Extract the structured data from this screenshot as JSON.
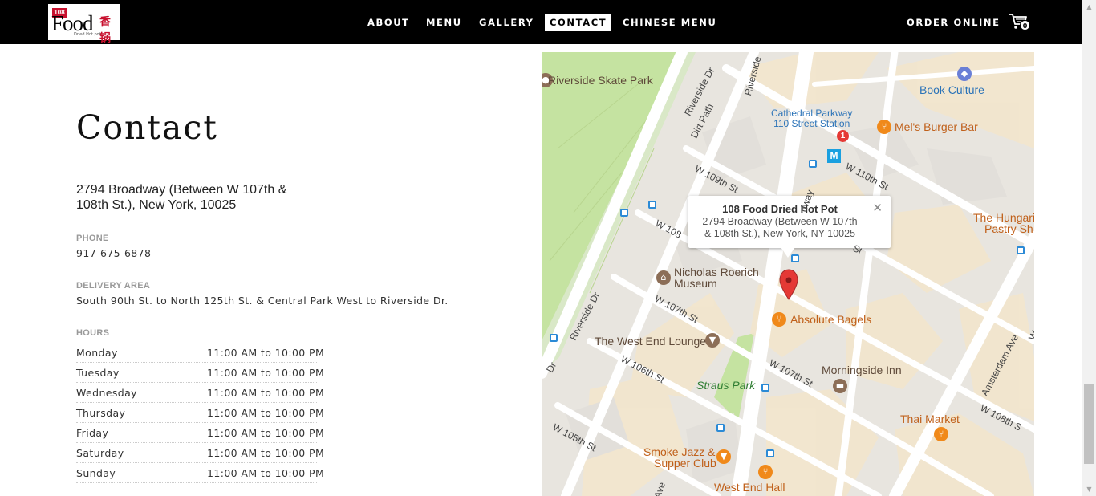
{
  "brand": {
    "logo_badge": "108",
    "logo_word": "Food",
    "logo_cn": "香锅",
    "logo_tagline": "Dried Hot pot"
  },
  "nav": {
    "items": [
      {
        "label": "ABOUT"
      },
      {
        "label": "MENU"
      },
      {
        "label": "GALLERY"
      },
      {
        "label": "CONTACT",
        "active": true
      },
      {
        "label": "CHINESE MENU"
      }
    ],
    "order_label": "ORDER ONLINE",
    "cart_count": "0"
  },
  "contact": {
    "title": "Contact",
    "address_line1": "2794 Broadway (Between W 107th &",
    "address_line2": "108th St.), New York, 10025",
    "phone_label": "PHONE",
    "phone": "917-675-6878",
    "delivery_label": "DELIVERY AREA",
    "delivery": "South 90th St. to North 125th St. & Central Park West to Riverside Dr.",
    "hours_label": "HOURS",
    "hours": [
      {
        "day": "Monday",
        "time": "11:00 AM to 10:00 PM"
      },
      {
        "day": "Tuesday",
        "time": "11:00 AM to 10:00 PM"
      },
      {
        "day": "Wednesday",
        "time": "11:00 AM to 10:00 PM"
      },
      {
        "day": "Thursday",
        "time": "11:00 AM to 10:00 PM"
      },
      {
        "day": "Friday",
        "time": "11:00 AM to 10:00 PM"
      },
      {
        "day": "Saturday",
        "time": "11:00 AM to 10:00 PM"
      },
      {
        "day": "Sunday",
        "time": "11:00 AM to 10:00 PM"
      }
    ]
  },
  "map": {
    "info_title": "108 Food Dried Hot Pot",
    "info_address_1": "2794 Broadway (Between W 107th",
    "info_address_2": "& 108th St.), New York, NY 10025",
    "close_glyph": "✕",
    "labels": {
      "riverside_skate_park": "Riverside Skate Park",
      "book_culture": "Book Culture",
      "cathedral_1": "Cathedral Parkway",
      "cathedral_2": "110 Street Station",
      "mels": "Mel's Burger Bar",
      "w109": "W 109th St",
      "w110": "W 110th St",
      "hungarian_1": "The Hungari",
      "hungarian_2": "Pastry Sh",
      "nicholas_1": "Nicholas Roerich",
      "nicholas_2": "Museum",
      "absolute": "Absolute Bagels",
      "w107_left": "W 107th St",
      "w107_right": "W 107th St",
      "riverside_dr": "Riverside Dr",
      "riverside_dr_top": "Riverside Dr",
      "riverside_top": "Riverside",
      "dirt_path": "Dirt Path",
      "broadway_frag": "dway",
      "w108_frag": "W 108",
      "st_frag": "St",
      "dr_frag": "Dr",
      "w_frag": "W",
      "ave_frag": "Ave",
      "west_end_lounge": "The West End Lounge",
      "morningside": "Morningside Inn",
      "w106": "W 106th St",
      "straus": "Straus Park",
      "amsterdam": "Amsterdam Ave",
      "w108_right": "W 108th S",
      "thai": "Thai Market",
      "w105": "W 105th St",
      "smoke_1": "Smoke Jazz &",
      "smoke_2": "Supper Club",
      "west_end_hall": "West End Hall",
      "metro": "M",
      "route": "1"
    }
  }
}
